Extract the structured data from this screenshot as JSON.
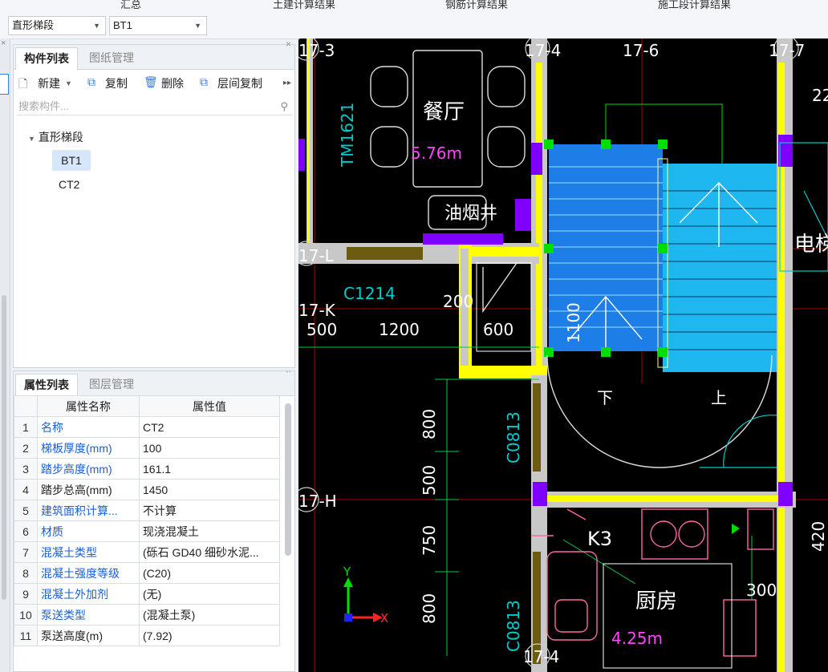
{
  "top_tabs": [
    "汇总",
    "土建计算结果",
    "钢筋计算结果",
    "施工段计算结果"
  ],
  "type_select": "直形梯段",
  "component_select": "BT1",
  "component_panel": {
    "tabs": [
      "构件列表",
      "图纸管理"
    ],
    "toolbar": {
      "new": "新建",
      "copy": "复制",
      "delete": "删除",
      "floor_copy": "层间复制"
    },
    "search_placeholder": "搜索构件...",
    "tree_group": "直形梯段",
    "items": [
      "BT1",
      "CT2"
    ],
    "selected": "BT1"
  },
  "property_panel": {
    "tabs": [
      "属性列表",
      "图层管理"
    ],
    "headers": [
      "属性名称",
      "属性值"
    ],
    "rows": [
      {
        "n": "1",
        "name": "名称",
        "value": "CT2",
        "blue": true
      },
      {
        "n": "2",
        "name": "梯板厚度(mm)",
        "value": "100",
        "blue": true
      },
      {
        "n": "3",
        "name": "踏步高度(mm)",
        "value": "161.1",
        "blue": true
      },
      {
        "n": "4",
        "name": "踏步总高(mm)",
        "value": "1450",
        "blue": false
      },
      {
        "n": "5",
        "name": "建筑面积计算...",
        "value": "不计算",
        "blue": true
      },
      {
        "n": "6",
        "name": "材质",
        "value": "现浇混凝土",
        "blue": true
      },
      {
        "n": "7",
        "name": "混凝土类型",
        "value": "(砾石 GD40 细砂水泥...",
        "blue": true
      },
      {
        "n": "8",
        "name": "混凝土强度等级",
        "value": "(C20)",
        "blue": true
      },
      {
        "n": "9",
        "name": "混凝土外加剂",
        "value": "(无)",
        "blue": true
      },
      {
        "n": "10",
        "name": "泵送类型",
        "value": "(混凝土泵)",
        "blue": true
      },
      {
        "n": "11",
        "name": "泵送高度(m)",
        "value": "(7.92)",
        "blue": false
      }
    ]
  },
  "cad": {
    "axis_labels": [
      "17-3",
      "17-4",
      "17-6",
      "17-7",
      "17-L",
      "17-K",
      "17-H",
      "17-4"
    ],
    "rooms": {
      "dining": "餐厅",
      "dining_height": "5.76m",
      "shaft": "油烟井",
      "kitchen": "厨房",
      "kitchen_height": "4.25m",
      "elevator": "电梯"
    },
    "tags": {
      "tm": "TM1621",
      "c1214": "C1214",
      "c0813a": "C0813",
      "c0813b": "C0813",
      "k3": "K3",
      "down": "下",
      "up": "上"
    },
    "dims": {
      "d500": "500",
      "d1200": "1200",
      "d200": "200",
      "d600": "600",
      "d1100": "1100",
      "d800a": "800",
      "d500b": "500",
      "d750": "750",
      "d800b": "800",
      "d300": "300",
      "d22": "22",
      "d420": "420"
    },
    "axes": {
      "x": "X",
      "y": "Y"
    }
  }
}
